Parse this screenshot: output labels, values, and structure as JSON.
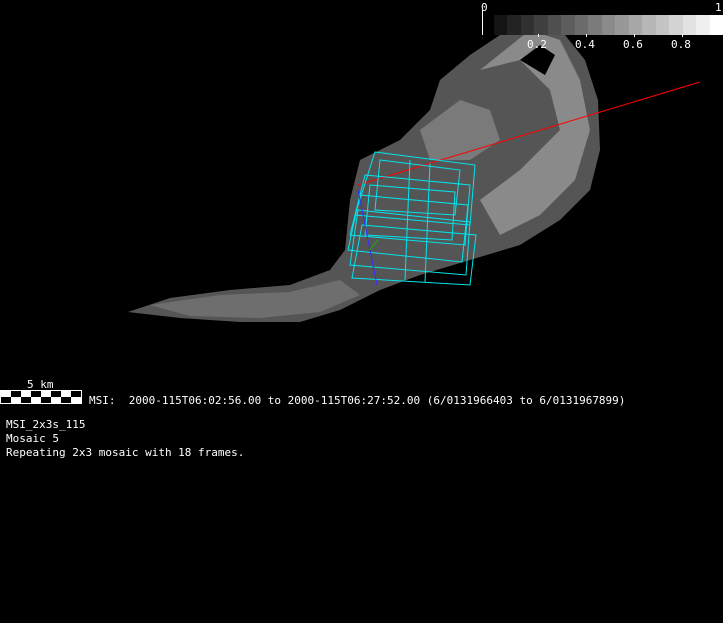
{
  "colorbar": {
    "min_label": "0",
    "max_label": "1",
    "ticks": [
      "0.2",
      "0.4",
      "0.6",
      "0.8"
    ],
    "steps": 17
  },
  "scale_bar": {
    "label": "5 km"
  },
  "info": {
    "instrument_line": "MSI:  2000-115T06:02:56.00 to 2000-115T06:27:52.00 (6/0131966403 to 6/0131967899)",
    "sequence_name": "MSI_2x3s_115",
    "mosaic": "Mosaic 5",
    "description": "Repeating 2x3 mosaic with 18 frames."
  },
  "colors": {
    "frustum": "#00e5ee",
    "sun_vector": "#ff0000",
    "axis_blue": "#3030ff",
    "axis_green": "#00c000"
  }
}
